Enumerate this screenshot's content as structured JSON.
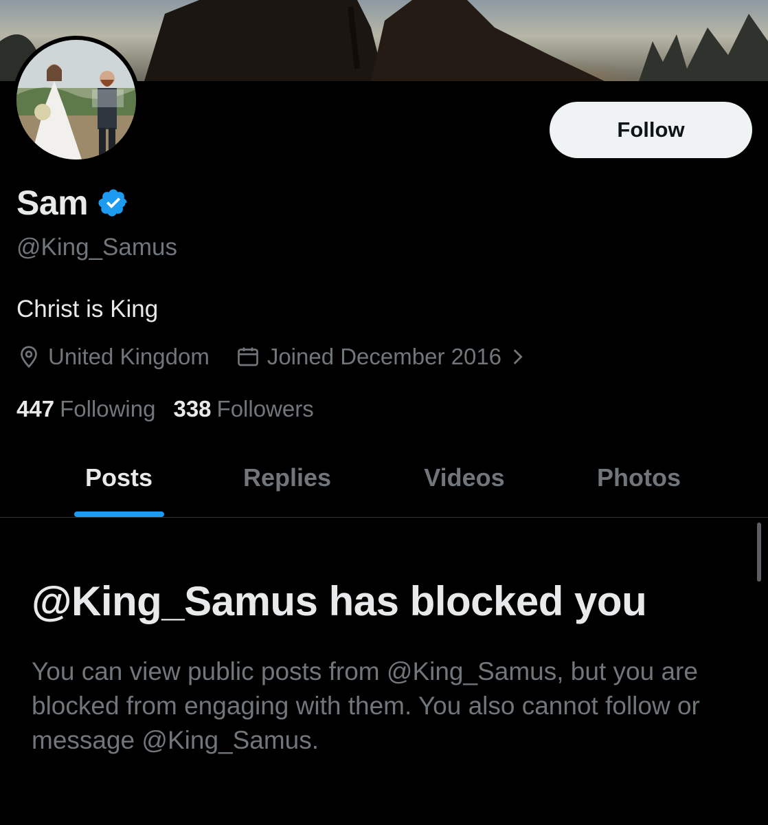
{
  "profile": {
    "display_name": "Sam",
    "verified_icon": "verified-badge-icon",
    "handle": "@King_Samus",
    "bio": "Christ is King",
    "location": "United Kingdom",
    "joined": "Joined December 2016",
    "following_count": "447",
    "following_label": "Following",
    "followers_count": "338",
    "followers_label": "Followers"
  },
  "actions": {
    "follow_label": "Follow"
  },
  "tabs": [
    {
      "label": "Posts",
      "active": true
    },
    {
      "label": "Replies",
      "active": false
    },
    {
      "label": "Videos",
      "active": false
    },
    {
      "label": "Photos",
      "active": false
    }
  ],
  "blocked": {
    "title": "@King_Samus has blocked you",
    "message": "You can view public posts from @King_Samus, but you are blocked from engaging with them. You also cannot follow or message @King_Samus."
  },
  "colors": {
    "background": "#000000",
    "text_primary": "#e7e9ea",
    "text_secondary": "#71767b",
    "accent": "#1d9bf0",
    "follow_button_bg": "#eff3f4"
  }
}
